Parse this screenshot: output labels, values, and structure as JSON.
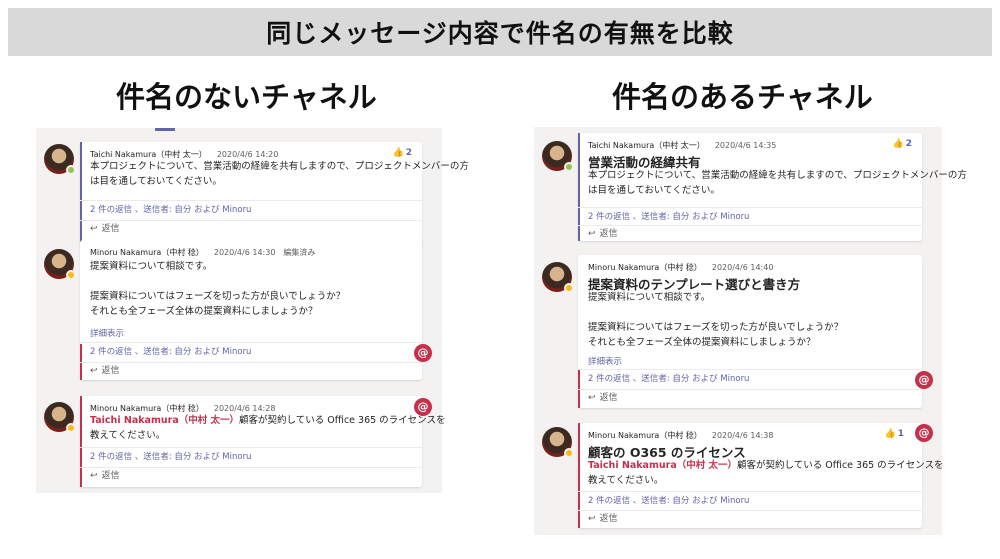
{
  "title": "同じメッセージ内容で件名の有無を比較",
  "left": {
    "heading": "件名のないチャネル",
    "posts": [
      {
        "author": "Taichi Nakamura（中村 太一）",
        "time": "2020/4/6 14:20",
        "likes": "2",
        "body": [
          "本プロジェクトについて、営業活動の経緯を共有しますので、プロジェクトメンバーの方",
          "は目を通しておいてください。"
        ],
        "replies": "2 件の返信 、送信者: 自分 および Minoru",
        "reply_label": "返信"
      },
      {
        "author": "Minoru Nakamura（中村 稔）",
        "time": "2020/4/6 14:30",
        "edited": "編集済み",
        "body": [
          "提案資料について相談です。",
          "",
          "提案資料についてはフェーズを切った方が良いでしょうか？",
          "それとも全フェーズ全体の提案資料にしましょうか？"
        ],
        "detail": "詳細表示",
        "replies": "2 件の返信 、送信者: 自分 および Minoru",
        "reply_label": "返信"
      },
      {
        "author": "Minoru Nakamura（中村 稔）",
        "time": "2020/4/6 14:28",
        "mention": "Taichi Nakamura（中村 太一）",
        "body_after_mention": "顧客が契約している Office 365 のライセンスを",
        "body_line2": "教えてください。",
        "replies": "2 件の返信 、送信者: 自分 および Minoru",
        "reply_label": "返信"
      }
    ]
  },
  "right": {
    "heading": "件名のあるチャネル",
    "posts": [
      {
        "author": "Taichi Nakamura（中村 太一）",
        "time": "2020/4/6 14:35",
        "likes": "2",
        "subject": "営業活動の経緯共有",
        "body": [
          "本プロジェクトについて、営業活動の経緯を共有しますので、プロジェクトメンバーの方",
          "は目を通しておいてください。"
        ],
        "replies": "2 件の返信 、送信者: 自分 および Minoru",
        "reply_label": "返信"
      },
      {
        "author": "Minoru Nakamura（中村 稔）",
        "time": "2020/4/6 14:40",
        "subject": "提案資料のテンプレート選びと書き方",
        "body": [
          "提案資料について相談です。",
          "",
          "提案資料についてはフェーズを切った方が良いでしょうか？",
          "それとも全フェーズ全体の提案資料にしましょうか？"
        ],
        "detail": "詳細表示",
        "replies": "2 件の返信 、送信者: 自分 および Minoru",
        "reply_label": "返信"
      },
      {
        "author": "Minoru Nakamura（中村 稔）",
        "time": "2020/4/6 14:38",
        "likes": "1",
        "subject": "顧客の O365 のライセンス",
        "mention": "Taichi Nakamura（中村 太一）",
        "body_after_mention": "顧客が契約している Office 365 のライセンスを",
        "body_line2": "教えてください。",
        "replies": "2 件の返信 、送信者: 自分 および Minoru",
        "reply_label": "返信"
      }
    ]
  },
  "icons": {
    "like": "thumbs-up-icon",
    "mention": "at-mention-icon",
    "reply": "reply-arrow-icon"
  },
  "colors": {
    "accent": "#6264a7",
    "mention": "#c4314b",
    "panel_bg": "#f3f2f1"
  }
}
